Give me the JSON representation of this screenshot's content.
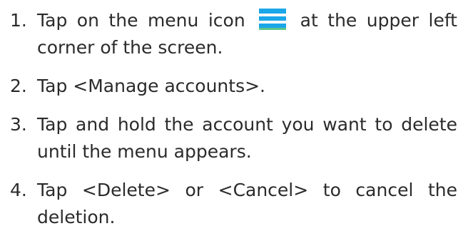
{
  "steps": [
    {
      "number": "1.",
      "text_before": "Tap on the menu icon",
      "icon": "menu-icon",
      "text_after": "at the upper left corner of the screen."
    },
    {
      "number": "2.",
      "text": "Tap <Manage accounts>."
    },
    {
      "number": "3.",
      "text": "Tap and hold the account you want to delete until the menu appears."
    },
    {
      "number": "4.",
      "text": "Tap <Delete> or <Cancel> to cancel the deletion."
    }
  ],
  "colors": {
    "text": "#2b2b2b",
    "icon_primary": "#1aa6e8",
    "icon_accent": "#5ac58a"
  }
}
